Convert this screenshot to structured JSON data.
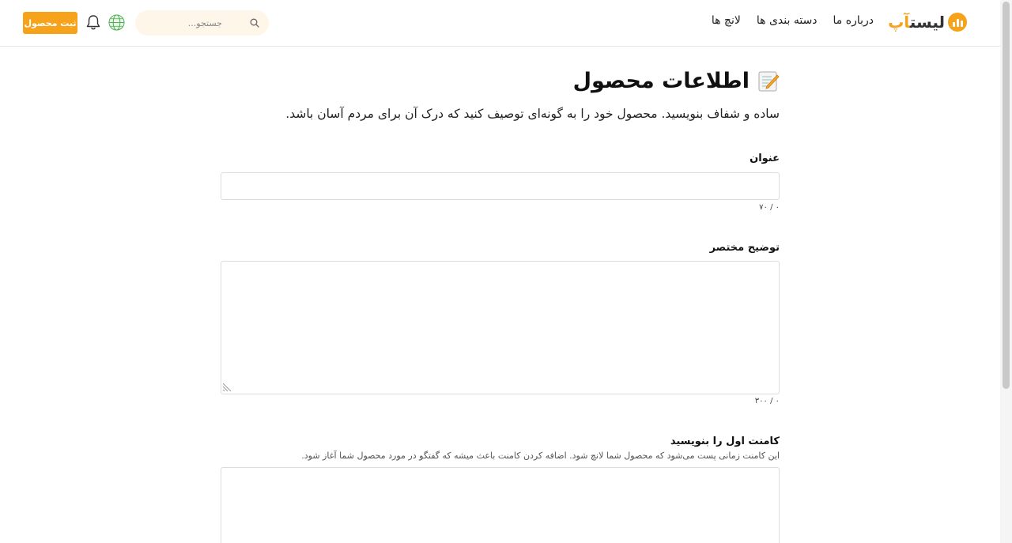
{
  "header": {
    "logo_text_dark": "لیست",
    "logo_text_accent": "آپ",
    "nav": [
      "لانچ ها",
      "دسته بندی ها",
      "درباره ما"
    ],
    "search_placeholder": "جستجو...",
    "submit_label": "ثبت محصول",
    "accent_color": "#f7a21b"
  },
  "page": {
    "title": "اطلاعات محصول",
    "subtitle": "ساده و شفاف بنویسید. محصول خود را به گونه‌ای توصیف کنید که درک آن برای مردم آسان باشد."
  },
  "form": {
    "title_field": {
      "label": "عنوان",
      "value": "",
      "counter": "۰ / ۷۰"
    },
    "summary_field": {
      "label": "توضیح مختصر",
      "value": "",
      "counter": "۰ / ۳۰۰"
    },
    "comment_field": {
      "label": "کامنت اول را بنویسید",
      "hint": "این کامنت زمانی پست می‌شود که محصول شما لانچ شود. اضافه کردن کامنت باعث میشه که گفتگو در مورد محصول شما آغاز شود.",
      "value": ""
    }
  },
  "icons": {
    "logo": "chart-bubble-icon",
    "search": "search-icon",
    "language": "globe-icon",
    "notifications": "bell-icon",
    "title": "memo-icon"
  }
}
